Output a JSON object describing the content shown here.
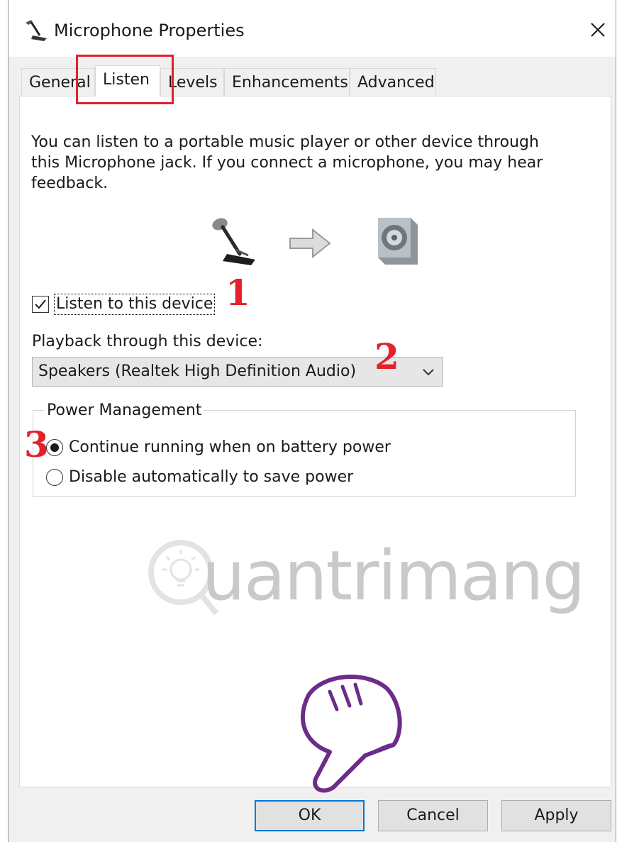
{
  "window": {
    "title": "Microphone Properties"
  },
  "tabs": [
    {
      "label": "General"
    },
    {
      "label": "Listen",
      "active": true
    },
    {
      "label": "Levels"
    },
    {
      "label": "Enhancements"
    },
    {
      "label": "Advanced"
    }
  ],
  "listen": {
    "description": "You can listen to a portable music player or other device through\nthis Microphone jack.  If you connect a microphone, you may hear\nfeedback.",
    "listen_checkbox": {
      "label": "Listen to this device",
      "checked": true
    },
    "playback_label": "Playback through this device:",
    "playback_device": "Speakers (Realtek High Definition Audio)",
    "power_management": {
      "legend": "Power Management",
      "options": [
        {
          "label": "Continue running when on battery power",
          "selected": true
        },
        {
          "label": "Disable automatically to save power",
          "selected": false
        }
      ]
    }
  },
  "annotations": {
    "step1": "1",
    "step2": "2",
    "step3": "3",
    "highlight_color": "#e3202b"
  },
  "watermark": {
    "text": "uantrimang"
  },
  "buttons": {
    "ok": "OK",
    "cancel": "Cancel",
    "apply": "Apply"
  },
  "icons": [
    "microphone-icon",
    "close-icon",
    "arrow-right-icon",
    "speaker-icon",
    "chevron-down-icon",
    "pointing-hand-icon",
    "lightbulb-icon"
  ],
  "colors": {
    "accent": "#0078d7",
    "annotation": "#e3202b",
    "hand": "#6b2c8a"
  }
}
